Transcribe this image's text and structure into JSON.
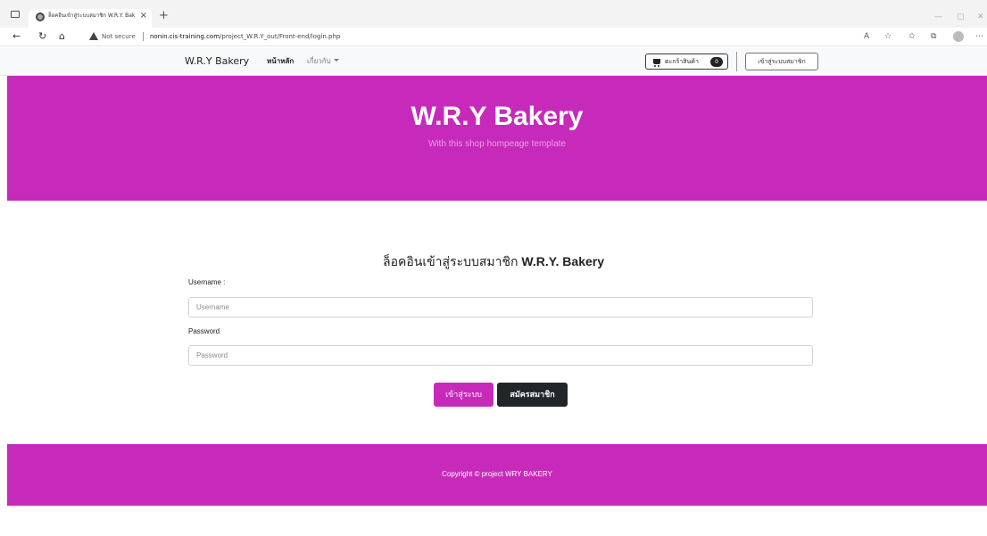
{
  "browser": {
    "tab_title": "ล็อคอินเข้าสู่ระบบสมาชิก W.R.Y. Bak",
    "tab_close": "×",
    "new_tab": "+",
    "not_secure": "Not secure",
    "url_host": "nonin.cis-training.com",
    "url_path": "/project_W.R.Y_out/Front-end/login.php",
    "icons": [
      "sidebar-toggle-icon",
      "globe-icon",
      "back-icon",
      "refresh-icon",
      "home-icon",
      "warning-icon",
      "read-aloud-icon",
      "add-favorite-icon",
      "favorites-icon",
      "collections-icon",
      "profile-icon",
      "more-icon"
    ]
  },
  "navbar": {
    "brand": "W.R.Y Bakery",
    "home": "หน้าหลัก",
    "about": "เกี่ยวกับ",
    "cart_label": "ตะกร้าสินค้า",
    "cart_count": "0",
    "member_login": "เข้าสู่ระบบสมาชิก"
  },
  "hero": {
    "title": "W.R.Y Bakery",
    "subtitle": "With this shop hompeage template"
  },
  "login": {
    "title_thai": "ล็อคอินเข้าสู่ระบบสมาชิก",
    "title_brand": "W.R.Y. Bakery",
    "username_label": "Username :",
    "username_placeholder": "Username",
    "username_value": "",
    "password_label": "Password",
    "password_placeholder": "Password",
    "password_value": "",
    "login_button": "เข้าสู่ระบบ",
    "register_button": "สมัครสมาชิก"
  },
  "footer": {
    "copyright": "Copyright © project WRY BAKERY"
  },
  "colors": {
    "brand_magenta": "#c72abb",
    "dark_button": "#222629",
    "navbar_bg": "#f8f9fa"
  }
}
